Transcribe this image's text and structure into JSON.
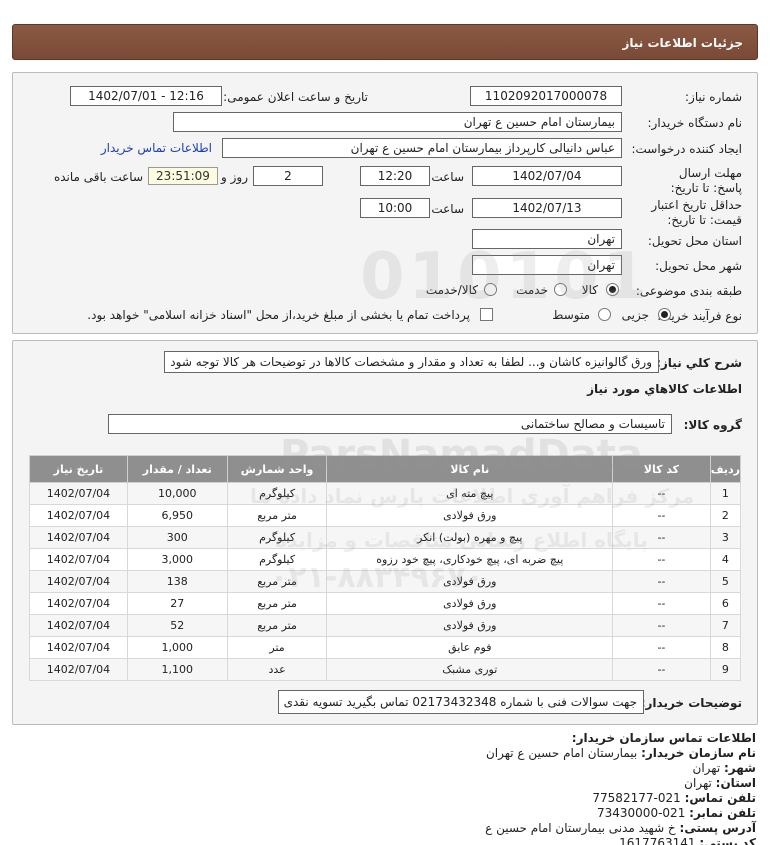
{
  "page_title": "جزئیات اطلاعات نیاز",
  "fields": {
    "need_number_label": "شماره نیاز:",
    "need_number": "1102092017000078",
    "announce_label": "تاریخ و ساعت اعلان عمومی:",
    "announce_value": "1402/07/01 - 12:16",
    "buyer_org_label": "نام دستگاه خریدار:",
    "buyer_org": "بیمارستان امام حسین  ع  تهران",
    "requester_label": "ایجاد کننده درخواست:",
    "requester": "عباس دانیالی کارپرداز بیمارستان امام حسین  ع  تهران",
    "contact_link": "اطلاعات تماس خریدار",
    "deadline_label": "مهلت ارسال پاسخ: تا تاریخ:",
    "deadline_date": "1402/07/04",
    "time_label": "ساعت",
    "deadline_time": "12:20",
    "days_value": "2",
    "days_label": "روز و",
    "remaining_time": "23:51:09",
    "remaining_label": "ساعت باقی مانده",
    "validity_label": "حداقل تاریخ اعتبار قیمت: تا تاریخ:",
    "validity_date": "1402/07/13",
    "validity_time": "10:00",
    "province_label": "استان محل تحویل:",
    "province": "تهران",
    "city_label": "شهر محل تحویل:",
    "city": "تهران",
    "category_label": "طبقه بندی موضوعی:",
    "category_options": [
      "کالا",
      "خدمت",
      "کالا/خدمت"
    ],
    "category_selected": "کالا",
    "process_label": "نوع فرآیند خرید :",
    "process_options": [
      "جزیی",
      "متوسط"
    ],
    "process_selected": "جزیی",
    "payment_note": "پرداخت تمام یا بخشی از مبلغ خرید،از محل \"اسناد خزانه اسلامی\" خواهد بود."
  },
  "description": {
    "label": "شرح کلي نياز:",
    "text": "ورق گالوانیزه کاشان و... لطفا به تعداد و مقدار و مشخصات کالاها در توضیحات هر کالا توجه شود"
  },
  "items_section": {
    "title": "اطلاعات كالاهاي مورد نياز",
    "group_label": "گروه کالا:",
    "group_value": "تاسیسات و مصالح ساختمانی",
    "columns": [
      "ردیف",
      "کد کالا",
      "نام کالا",
      "واحد شمارش",
      "تعداد / مقدار",
      "تاریخ نیاز"
    ],
    "rows": [
      [
        "1",
        "--",
        "پیچ مته ای",
        "کیلوگرم",
        "10,000",
        "1402/07/04"
      ],
      [
        "2",
        "--",
        "ورق فولادی",
        "متر مربع",
        "6,950",
        "1402/07/04"
      ],
      [
        "3",
        "--",
        "پیچ و مهره (بولت) انکر",
        "کیلوگرم",
        "300",
        "1402/07/04"
      ],
      [
        "4",
        "--",
        "پیچ ضربه ای، پیچ خودکاری، پیچ خود رزوه",
        "کیلوگرم",
        "3,000",
        "1402/07/04"
      ],
      [
        "5",
        "--",
        "ورق فولادی",
        "متر مربع",
        "138",
        "1402/07/04"
      ],
      [
        "6",
        "--",
        "ورق فولادی",
        "متر مربع",
        "27",
        "1402/07/04"
      ],
      [
        "7",
        "--",
        "ورق فولادی",
        "متر مربع",
        "52",
        "1402/07/04"
      ],
      [
        "8",
        "--",
        "فوم عایق",
        "متر",
        "1,000",
        "1402/07/04"
      ],
      [
        "9",
        "--",
        "توری مشبک",
        "عدد",
        "1,100",
        "1402/07/04"
      ]
    ]
  },
  "buyer_notes": {
    "label": "توضیحات خریدار:",
    "text": "جهت سوالات فنی با شماره 02173432348 تماس بگیرید تسویه نقدی"
  },
  "contact": {
    "title": "اطلاعات تماس سازمان خریدار:",
    "rows": [
      {
        "label": "نام سازمان خریدار:",
        "value": "بیمارستان امام حسین ع تهران"
      },
      {
        "label": "شهر:",
        "value": "تهران"
      },
      {
        "label": "استان:",
        "value": "تهران"
      },
      {
        "label": "تلفن تماس:",
        "value": "021-77582177"
      },
      {
        "label": "تلفن نمابر:",
        "value": "021-73430000"
      },
      {
        "label": "آدرس پستی:",
        "value": "خ شهید مدنی بیمارستان امام حسین ع"
      },
      {
        "label": "کد پستی:",
        "value": "1617763141"
      }
    ]
  },
  "watermark": {
    "brand": "ParsNamadData",
    "line1": "مرکز فراهم آوری اطلاعات پارس نماد داده ها",
    "line2": "پایگاه اطلاع رسانی مناقصات و مزایده",
    "phone": "۰۲۱-۸۸۳۴۹۶۷۰",
    "number": "010101"
  }
}
